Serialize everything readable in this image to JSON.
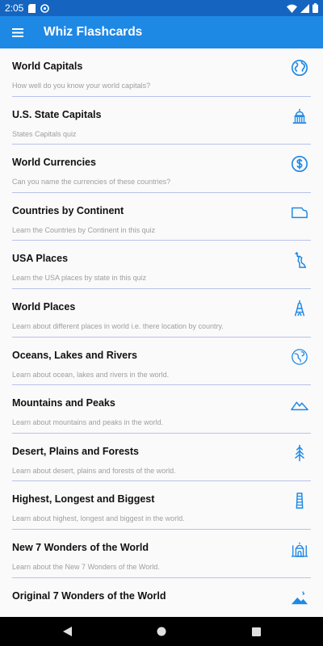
{
  "status": {
    "time": "2:05"
  },
  "app": {
    "title": "Whiz Flashcards"
  },
  "items": [
    {
      "title": "World Capitals",
      "subtitle": "How well do you know your world capitals?",
      "icon": "globe-icon"
    },
    {
      "title": "U.S. State Capitals",
      "subtitle": "States Capitals  quiz",
      "icon": "capitol-building-icon"
    },
    {
      "title": "World Currencies",
      "subtitle": "Can you name the currencies of these countries?",
      "icon": "dollar-icon"
    },
    {
      "title": "Countries by Continent",
      "subtitle": "Learn the Countries by Continent in this quiz",
      "icon": "map-outline-icon"
    },
    {
      "title": "USA Places",
      "subtitle": "Learn the USA places by state in this quiz",
      "icon": "statue-of-liberty-icon"
    },
    {
      "title": "World Places",
      "subtitle": "Learn about different places in world i.e. there location by country.",
      "icon": "eiffel-tower-icon"
    },
    {
      "title": "Oceans, Lakes and Rivers",
      "subtitle": "Learn about ocean, lakes and rivers in the world.",
      "icon": "earth-water-icon"
    },
    {
      "title": "Mountains and Peaks",
      "subtitle": "Learn about mountains and peaks in the world.",
      "icon": "mountain-icon"
    },
    {
      "title": "Desert, Plains and Forests",
      "subtitle": "Learn about desert, plains and forests of the world.",
      "icon": "pine-tree-icon"
    },
    {
      "title": "Highest, Longest and Biggest",
      "subtitle": "Learn about highest, longest and biggest in the world.",
      "icon": "leaning-tower-icon"
    },
    {
      "title": "New 7 Wonders of the World",
      "subtitle": "Learn about the New 7 Wonders of the World.",
      "icon": "taj-mahal-icon"
    },
    {
      "title": "Original 7 Wonders of the World",
      "subtitle": "",
      "icon": "pyramids-icon"
    }
  ],
  "colors": {
    "status_bar": "#1565c0",
    "app_bar": "#1e88e5",
    "icon": "#1e88e5",
    "divider": "#b9c2ea"
  }
}
